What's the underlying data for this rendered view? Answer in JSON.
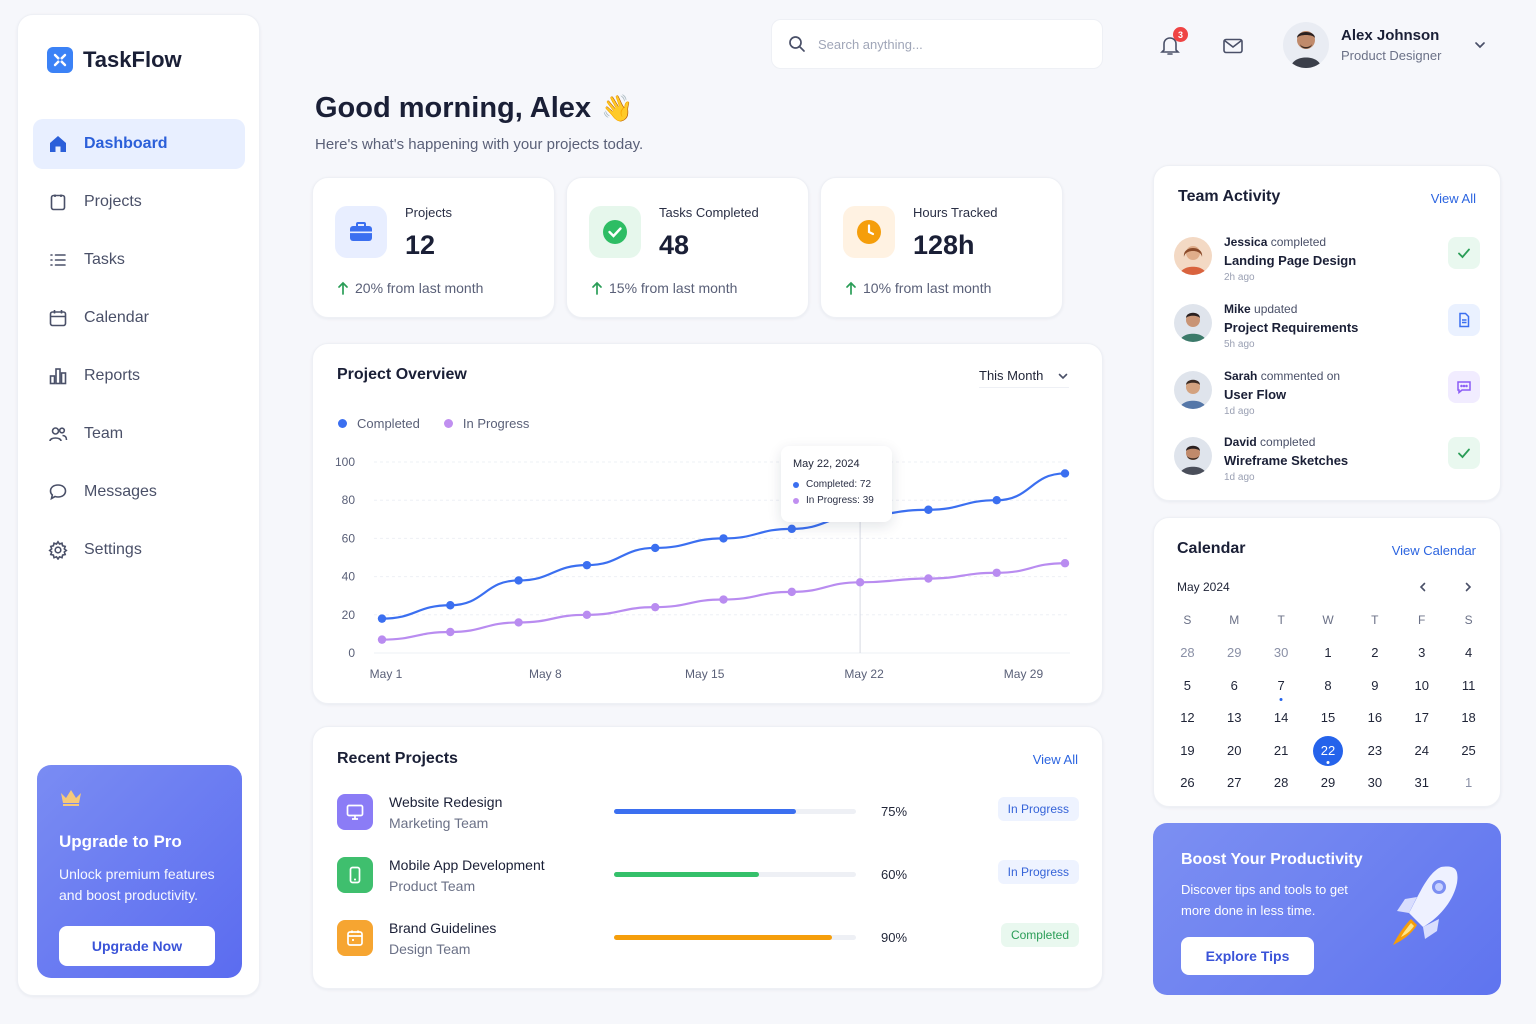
{
  "app": {
    "name": "TaskFlow"
  },
  "sidebar": {
    "items": [
      {
        "label": "Dashboard",
        "icon": "home-icon",
        "active": true
      },
      {
        "label": "Projects",
        "icon": "clipboard-icon"
      },
      {
        "label": "Tasks",
        "icon": "list-icon"
      },
      {
        "label": "Calendar",
        "icon": "calendar-icon"
      },
      {
        "label": "Reports",
        "icon": "bar-chart-icon"
      },
      {
        "label": "Team",
        "icon": "users-icon"
      },
      {
        "label": "Messages",
        "icon": "chat-icon"
      },
      {
        "label": "Settings",
        "icon": "gear-icon"
      }
    ],
    "upgrade": {
      "title": "Upgrade to Pro",
      "description": "Unlock premium features and boost productivity.",
      "button": "Upgrade Now"
    }
  },
  "topbar": {
    "search_placeholder": "Search anything...",
    "notifications_count": "3",
    "user": {
      "name": "Alex Johnson",
      "role": "Product Designer"
    }
  },
  "greeting": {
    "title": "Good morning, Alex",
    "emoji": "👋",
    "subtitle": "Here's what's happening with your projects today."
  },
  "stats": [
    {
      "label": "Projects",
      "value": "12",
      "change": "20% from last month"
    },
    {
      "label": "Tasks Completed",
      "value": "48",
      "change": "15% from last month"
    },
    {
      "label": "Hours Tracked",
      "value": "128h",
      "change": "10% from last month"
    }
  ],
  "overview": {
    "title": "Project Overview",
    "range": "This Month",
    "tooltip": {
      "date": "May 22, 2024",
      "completed": "Completed: 72",
      "in_progress": "In Progress: 39"
    }
  },
  "chart_data": {
    "type": "line",
    "title": "Project Overview",
    "x_tick_labels": [
      "May 1",
      "May 8",
      "May 15",
      "May 22",
      "May 29"
    ],
    "x": [
      1,
      4,
      7,
      10,
      13,
      16,
      19,
      22,
      25,
      28,
      31
    ],
    "series": [
      {
        "name": "Completed",
        "color": "#3b6ff0",
        "values": [
          18,
          25,
          38,
          46,
          55,
          60,
          65,
          72,
          75,
          80,
          94
        ]
      },
      {
        "name": "In Progress",
        "color": "#b98cf0",
        "values": [
          7,
          11,
          16,
          20,
          24,
          28,
          32,
          37,
          39,
          42,
          47
        ]
      }
    ],
    "ylim": [
      0,
      100
    ],
    "y_ticks": [
      0,
      20,
      40,
      60,
      80,
      100
    ],
    "grid": true,
    "legend": "top-left",
    "highlight_x": 22
  },
  "recent_projects": {
    "title": "Recent Projects",
    "view_all": "View All",
    "items": [
      {
        "name": "Website Redesign",
        "team": "Marketing Team",
        "progress": 75,
        "progress_label": "75%",
        "status": "In Progress",
        "color": "#3b6ff0",
        "icon": "monitor-icon",
        "icon_bg": "#8b7cf6"
      },
      {
        "name": "Mobile App Development",
        "team": "Product Team",
        "progress": 60,
        "progress_label": "60%",
        "status": "In Progress",
        "color": "#34c06a",
        "icon": "phone-icon",
        "icon_bg": "#3fbf6e"
      },
      {
        "name": "Brand Guidelines",
        "team": "Design Team",
        "progress": 90,
        "progress_label": "90%",
        "status": "Completed",
        "color": "#f59e0b",
        "icon": "calendar-icon",
        "icon_bg": "#f6a531"
      }
    ]
  },
  "team_activity": {
    "title": "Team Activity",
    "view_all": "View All",
    "items": [
      {
        "name": "Jessica",
        "action": "completed",
        "target": "Landing Page Design",
        "time": "2h ago",
        "icon": "check-icon"
      },
      {
        "name": "Mike",
        "action": "updated",
        "target": "Project Requirements",
        "time": "5h ago",
        "icon": "document-icon"
      },
      {
        "name": "Sarah",
        "action": "commented on",
        "target": "User Flow",
        "time": "1d ago",
        "icon": "comment-icon"
      },
      {
        "name": "David",
        "action": "completed",
        "target": "Wireframe Sketches",
        "time": "1d ago",
        "icon": "check-icon"
      }
    ]
  },
  "calendar": {
    "title": "Calendar",
    "view": "View Calendar",
    "month": "May 2024",
    "weekdays": [
      "S",
      "M",
      "T",
      "W",
      "T",
      "F",
      "S"
    ],
    "days": [
      "28",
      "29",
      "30",
      "1",
      "2",
      "3",
      "4",
      "5",
      "6",
      "7",
      "8",
      "9",
      "10",
      "11",
      "12",
      "13",
      "14",
      "15",
      "16",
      "17",
      "18",
      "19",
      "20",
      "21",
      "22",
      "23",
      "24",
      "25",
      "26",
      "27",
      "28",
      "29",
      "30",
      "31",
      "1"
    ],
    "muted_indexes": [
      0,
      1,
      2,
      34
    ],
    "today_index": 24,
    "dot_indexes": [
      9,
      24
    ]
  },
  "boost": {
    "title": "Boost Your Productivity",
    "description": "Discover tips and tools to get more done in less time.",
    "button": "Explore Tips"
  }
}
